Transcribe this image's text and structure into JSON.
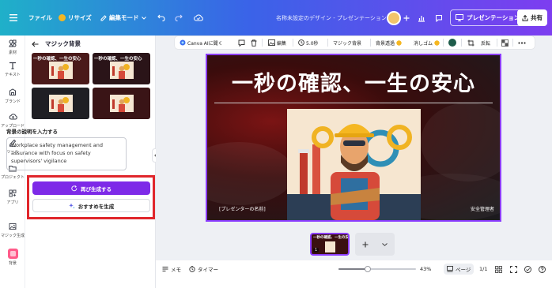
{
  "topbar": {
    "menu_icon": "hamburger-icon",
    "file_label": "ファイル",
    "resize_label": "リサイズ",
    "edit_mode_label": "編集モード",
    "doc_title": "名称未設定のデザイン - プレゼンテーション",
    "present_label": "プレゼンテーション",
    "share_label": "共有"
  },
  "rail": {
    "items": [
      {
        "label": "素材",
        "icon": "elements-icon"
      },
      {
        "label": "テキスト",
        "icon": "text-icon"
      },
      {
        "label": "ブランド",
        "icon": "brand-icon"
      },
      {
        "label": "アップロード",
        "icon": "upload-icon"
      },
      {
        "label": "ツール",
        "icon": "draw-icon"
      },
      {
        "label": "プロジェクト",
        "icon": "folder-icon"
      },
      {
        "label": "アプリ",
        "icon": "apps-icon"
      },
      {
        "label": "マジック生成",
        "icon": "magic-media-icon"
      },
      {
        "label": "背景",
        "icon": "background-icon"
      }
    ]
  },
  "panel": {
    "title": "マジック背景",
    "thumbnail_title": "一秒の確認、一生の安心",
    "description_label": "背景の説明を入力する",
    "description_value": "Workplace safety management and assurance with focus on safety supervisors' vigilance",
    "regenerate_label": "再び生成する",
    "suggest_label": "おすすめを生成"
  },
  "toolbar": {
    "canva_ai_label": "Canva AIに聞く",
    "edit_label": "編集",
    "duration_label": "5.0秒",
    "magic_bg_label": "マジック背景",
    "bg_remove_label": "背景透過",
    "eraser_label": "消しゴム",
    "flip_label": "反転",
    "swatch_color": "#1e5c4a"
  },
  "slide": {
    "title": "一秒の確認、一生の安心",
    "presenter": "[プレゼンターの名前]",
    "role": "安全管理者"
  },
  "pages": {
    "current_number": "1",
    "add_icon": "plus-icon"
  },
  "bottombar": {
    "notes_label": "メモ",
    "timer_label": "タイマー",
    "zoom": "43%",
    "zoom_fraction": 0.38,
    "page_view_label": "ページ",
    "page_count": "1/1"
  },
  "colors": {
    "accent": "#7d2ae8",
    "highlight": "#e0262b"
  }
}
